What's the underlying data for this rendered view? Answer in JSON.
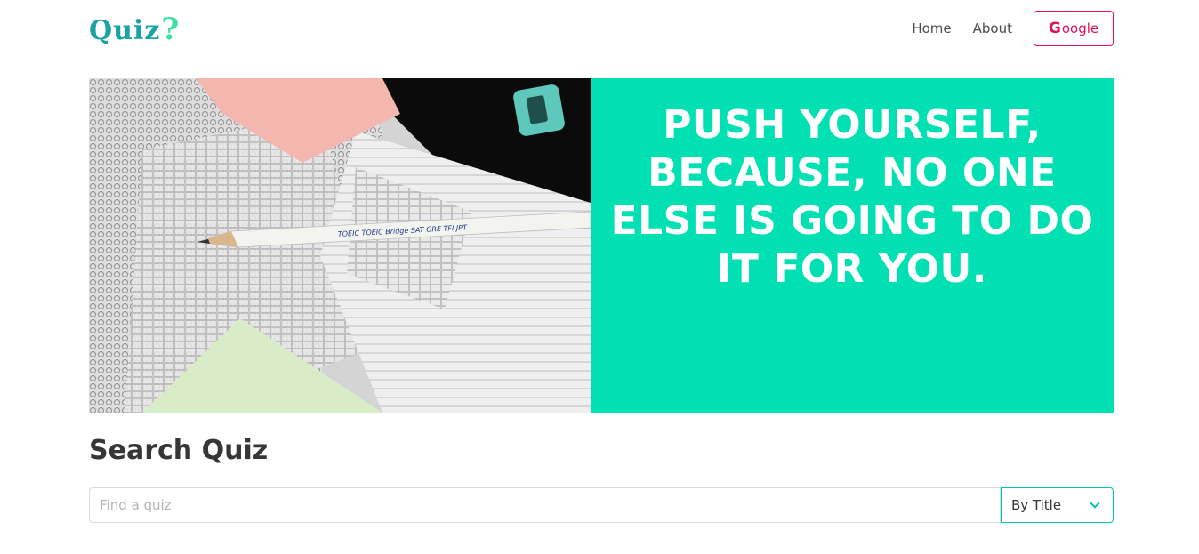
{
  "header": {
    "logo_text": "Quiz",
    "logo_mark": "?",
    "nav": [
      {
        "label": "Home"
      },
      {
        "label": "About"
      }
    ],
    "login_button": {
      "icon_glyph": "G",
      "label": "oogle"
    }
  },
  "hero": {
    "quote": "PUSH YOURSELF, BECAUSE, NO ONE ELSE IS GOING TO DO IT FOR YOU.",
    "image_pencil_text": "TOEIC  TOEIC Bridge  SAT  GRE  TFI  JPT",
    "colors": {
      "panel": "#00e0b2",
      "quote_text": "#ffffff"
    }
  },
  "search": {
    "title": "Search Quiz",
    "input": {
      "value": "",
      "placeholder": "Find a quiz"
    },
    "filter": {
      "selected": "By Title"
    }
  },
  "colors": {
    "brand": "#1aa3a3",
    "accent": "#00c4b4",
    "google_red": "#e0105c"
  }
}
